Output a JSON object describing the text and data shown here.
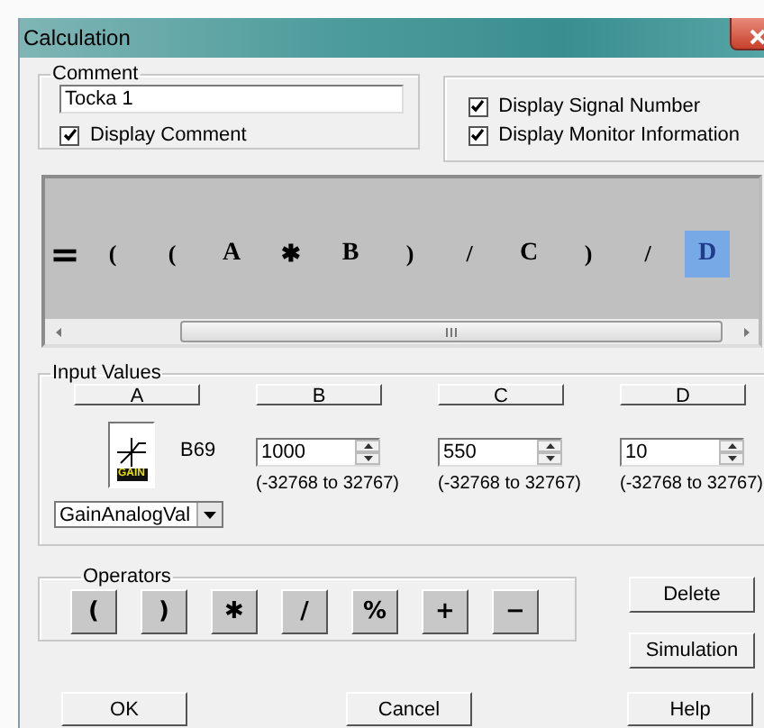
{
  "window": {
    "title": "Calculation"
  },
  "comment": {
    "legend": "Comment",
    "value": "Tocka 1",
    "display_comment": {
      "label": "Display Comment",
      "checked": true
    }
  },
  "display_options": [
    {
      "label": "Display Signal Number",
      "checked": true
    },
    {
      "label": "Display Monitor Information",
      "checked": true
    }
  ],
  "formula": [
    {
      "text": "=",
      "kind": "equals",
      "selected": false
    },
    {
      "text": "(",
      "kind": "operator",
      "selected": false
    },
    {
      "text": "(",
      "kind": "operator",
      "selected": false
    },
    {
      "text": "A",
      "kind": "operand",
      "selected": false
    },
    {
      "text": "✱",
      "kind": "operator",
      "selected": false
    },
    {
      "text": "B",
      "kind": "operand",
      "selected": false
    },
    {
      "text": ")",
      "kind": "operator",
      "selected": false
    },
    {
      "text": "/",
      "kind": "operator",
      "selected": false
    },
    {
      "text": "C",
      "kind": "operand",
      "selected": false
    },
    {
      "text": ")",
      "kind": "operator",
      "selected": false
    },
    {
      "text": "/",
      "kind": "operator",
      "selected": false
    },
    {
      "text": "D",
      "kind": "operand",
      "selected": true
    }
  ],
  "input_values": {
    "legend": "Input Values",
    "inputs": [
      {
        "label": "A",
        "kind": "signal",
        "signal": "B69",
        "icon_label": "GAIN"
      },
      {
        "label": "B",
        "kind": "number",
        "value": "1000",
        "range": "(-32768 to 32767)"
      },
      {
        "label": "C",
        "kind": "number",
        "value": "550",
        "range": "(-32768 to 32767)"
      },
      {
        "label": "D",
        "kind": "number",
        "value": "10",
        "range": "(-32768 to 32767)"
      }
    ],
    "dropdown": "GainAnalogVal"
  },
  "operators": {
    "legend": "Operators",
    "buttons": [
      "(",
      ")",
      "✱",
      "/",
      "%",
      "+",
      "−"
    ]
  },
  "side_buttons": [
    "Delete",
    "Simulation"
  ],
  "bottom_buttons": [
    "OK",
    "Cancel",
    "Help"
  ]
}
